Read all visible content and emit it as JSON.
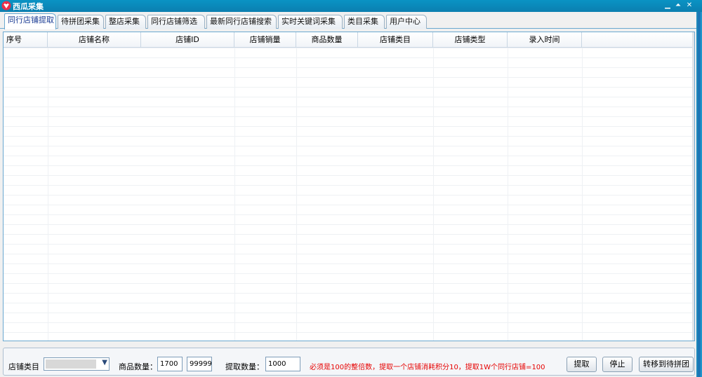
{
  "window": {
    "title": "西瓜采集"
  },
  "tabs": [
    {
      "label": "同行店铺提取",
      "active": true
    },
    {
      "label": "待拼团采集",
      "active": false
    },
    {
      "label": "整店采集",
      "active": false
    },
    {
      "label": "同行店铺筛选",
      "active": false
    },
    {
      "label": "最新同行店铺搜索",
      "active": false
    },
    {
      "label": "实时关键词采集",
      "active": false
    },
    {
      "label": "类目采集",
      "active": false
    },
    {
      "label": "用户中心",
      "active": false
    }
  ],
  "table": {
    "columns": [
      "序号",
      "店铺名称",
      "店铺ID",
      "店铺销量",
      "商品数量",
      "店铺类目",
      "店铺类型",
      "录入时间"
    ],
    "rows": []
  },
  "bottom": {
    "category_label": "店铺类目",
    "category_value": "",
    "goods_count_label": "商品数量：",
    "goods_min": "1700",
    "goods_max": "99999",
    "extract_count_label": "提取数量：",
    "extract_count": "1000",
    "warning": "必须是100的整倍数，提取一个店铺消耗积分10，提取1W个同行店铺=100",
    "extract_button": "提取",
    "stop_button": "停止",
    "transfer_button": "转移到待拼团"
  },
  "colors": {
    "titlebar": "#0b87bb",
    "warning": "#e60000",
    "accent_border": "#6aa8d0"
  }
}
